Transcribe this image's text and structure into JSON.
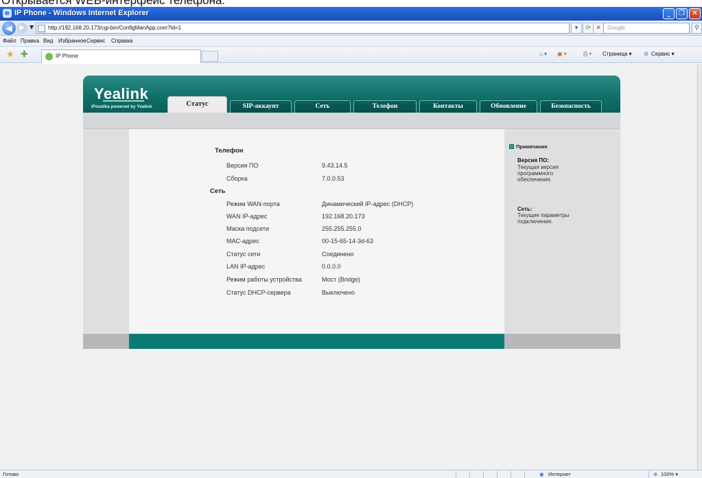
{
  "caption": "Открывается WEB-интерфейс телефона:",
  "window": {
    "title": "IP Phone - Windows Internet Explorer",
    "url": "http://192.168.20.173/cgi-bin/ConfigManApp.com?Id=1",
    "search_placeholder": "Google",
    "tab_label": "IP Phone"
  },
  "menu": [
    "Файл",
    "Правка",
    "Вид",
    "Избранное",
    "Сервис",
    "Справка"
  ],
  "toolbar_right": {
    "page": "Страница",
    "tools": "Сервис"
  },
  "brand": {
    "logo": "Yealink",
    "tagline": "IPmatika powered by Yealink"
  },
  "tabs": [
    "Статус",
    "SIP-аккаунт",
    "Сеть",
    "Телефон",
    "Контакты",
    "Обновление",
    "Безопасность"
  ],
  "status": {
    "phone_section": "Телефон",
    "phone_rows": [
      {
        "label": "Версия ПО",
        "value": "9.43.14.5"
      },
      {
        "label": "Сборка",
        "value": "7.0.0.53"
      }
    ],
    "network_section": "Сеть",
    "network_rows": [
      {
        "label": "Режим WAN-порта",
        "value": "Динамический IP-адрес (DHCP)"
      },
      {
        "label": "WAN IP-адрес",
        "value": "192.168.20.173"
      },
      {
        "label": "Маска подсети",
        "value": "255.255.255.0"
      },
      {
        "label": "MAC-адрес",
        "value": "00-15-65-14-3d-63"
      },
      {
        "label": "Статус сети",
        "value": "Соединено"
      },
      {
        "label": "LAN IP-адрес",
        "value": "0.0.0.0"
      },
      {
        "label": "Режим работы устройства",
        "value": "Мост (Bridge)"
      },
      {
        "label": "Статус DHCP-сервера",
        "value": "Выключено"
      }
    ]
  },
  "notes": {
    "header": "Примечание",
    "items": [
      {
        "title": "Версия ПО:",
        "text": "Текущая версия программного обеспечения."
      },
      {
        "title": "Сеть:",
        "text": "Текущие параметры подключения."
      }
    ]
  },
  "statusbar": {
    "left": "Готово",
    "zone": "Интернет",
    "zoom": "100%"
  }
}
